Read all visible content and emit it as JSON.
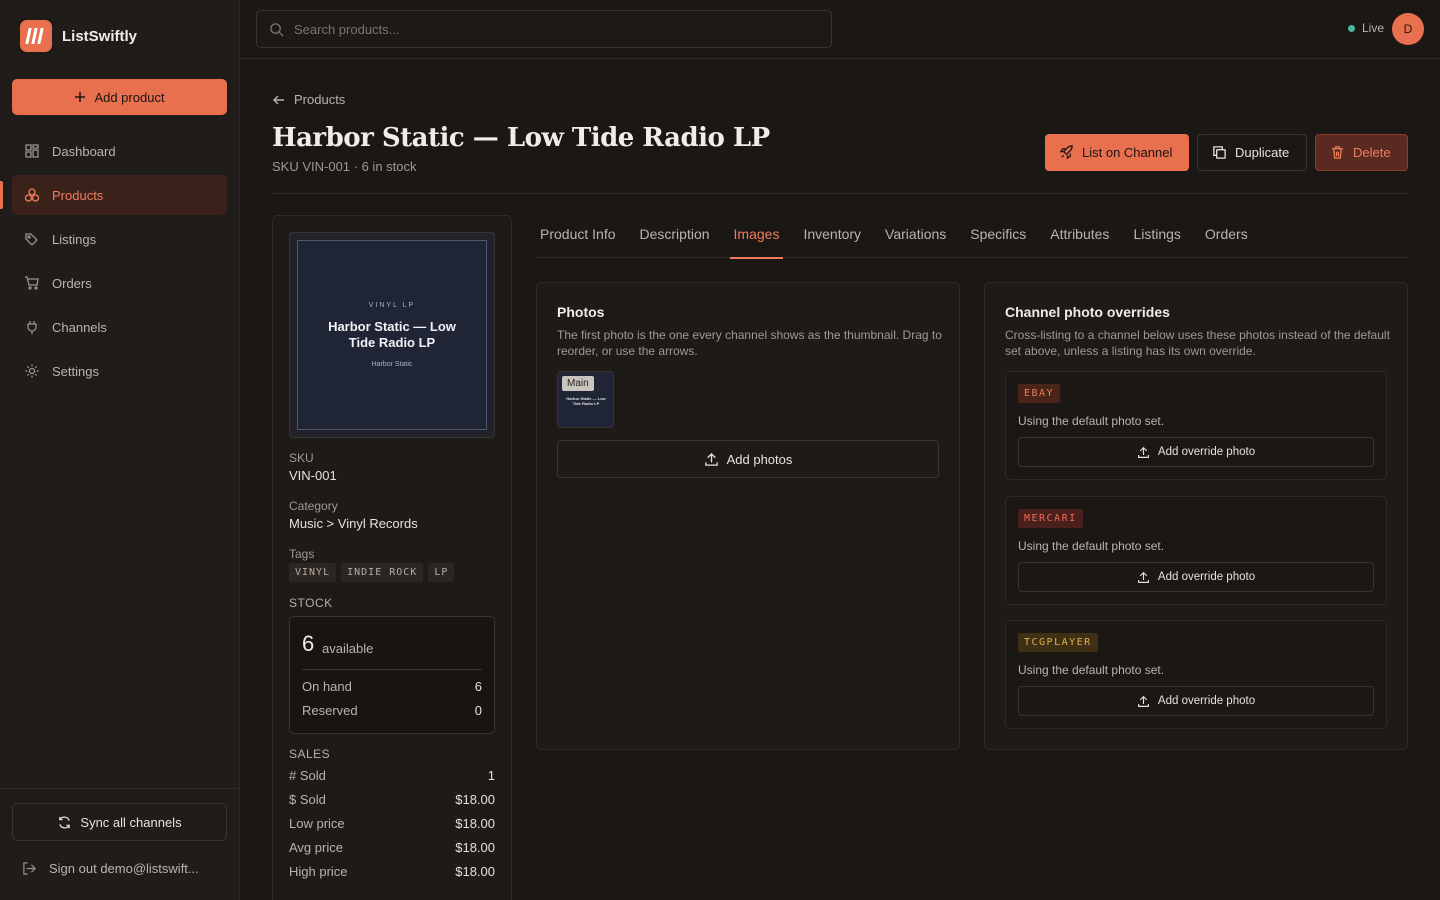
{
  "brand": {
    "name": "ListSwiftly"
  },
  "sidebar": {
    "add_label": "Add product",
    "items": [
      {
        "label": "Dashboard",
        "icon": "dashboard-icon"
      },
      {
        "label": "Products",
        "icon": "products-icon",
        "active": true
      },
      {
        "label": "Listings",
        "icon": "tag-icon"
      },
      {
        "label": "Orders",
        "icon": "cart-icon"
      },
      {
        "label": "Channels",
        "icon": "plug-icon"
      },
      {
        "label": "Settings",
        "icon": "gear-icon"
      }
    ],
    "sync_label": "Sync all channels",
    "signout_label": "Sign out demo@listswift..."
  },
  "topbar": {
    "search_placeholder": "Search products...",
    "status": "Live",
    "status_color": "#4fb79b",
    "avatar_initial": "D"
  },
  "page": {
    "breadcrumb": "Products",
    "title": "Harbor Static — Low Tide Radio LP",
    "subtitle": "SKU VIN-001 · 6 in stock",
    "actions": {
      "list": "List on Channel",
      "duplicate": "Duplicate",
      "delete": "Delete"
    }
  },
  "product": {
    "cover": {
      "kicker": "VINYL LP",
      "title": "Harbor Static — Low Tide Radio LP",
      "artist": "Harbor Static"
    },
    "sku_label": "SKU",
    "sku": "VIN-001",
    "category_label": "Category",
    "category": "Music > Vinyl Records",
    "tags_label": "Tags",
    "tags": [
      "VINYL",
      "INDIE ROCK",
      "LP"
    ],
    "stock_label": "STOCK",
    "stock": {
      "available": "6",
      "available_label": "available",
      "on_hand_label": "On hand",
      "on_hand": "6",
      "reserved_label": "Reserved",
      "reserved": "0"
    },
    "sales_label": "SALES",
    "sales": [
      {
        "label": "# Sold",
        "value": "1"
      },
      {
        "label": "$ Sold",
        "value": "$18.00"
      },
      {
        "label": "Low price",
        "value": "$18.00"
      },
      {
        "label": "Avg price",
        "value": "$18.00"
      },
      {
        "label": "High price",
        "value": "$18.00"
      }
    ]
  },
  "tabs": [
    "Product Info",
    "Description",
    "Images",
    "Inventory",
    "Variations",
    "Specifics",
    "Attributes",
    "Listings",
    "Orders"
  ],
  "active_tab": "Images",
  "photos": {
    "title": "Photos",
    "desc": "The first photo is the one every channel shows as the thumbnail. Drag to reorder, or use the arrows.",
    "main_badge": "Main",
    "thumb_title": "Harbor Static — Low Tide Radio LP",
    "add_label": "Add photos"
  },
  "overrides": {
    "title": "Channel photo overrides",
    "desc": "Cross-listing to a channel below uses these photos instead of the default set above, unless a listing has its own override.",
    "channels": [
      {
        "name": "EBAY",
        "note": "Using the default photo set.",
        "button": "Add override photo",
        "color": "#ef7d5c",
        "bg": "#4a2319"
      },
      {
        "name": "MERCARI",
        "note": "Using the default photo set.",
        "button": "Add override photo",
        "color": "#ef6a5a",
        "bg": "#4a201c"
      },
      {
        "name": "TCGPLAYER",
        "note": "Using the default photo set.",
        "button": "Add override photo",
        "color": "#e3b04a",
        "bg": "#3f3015"
      }
    ]
  },
  "colors": {
    "accent": "#e8704f",
    "background": "#1a1715"
  }
}
